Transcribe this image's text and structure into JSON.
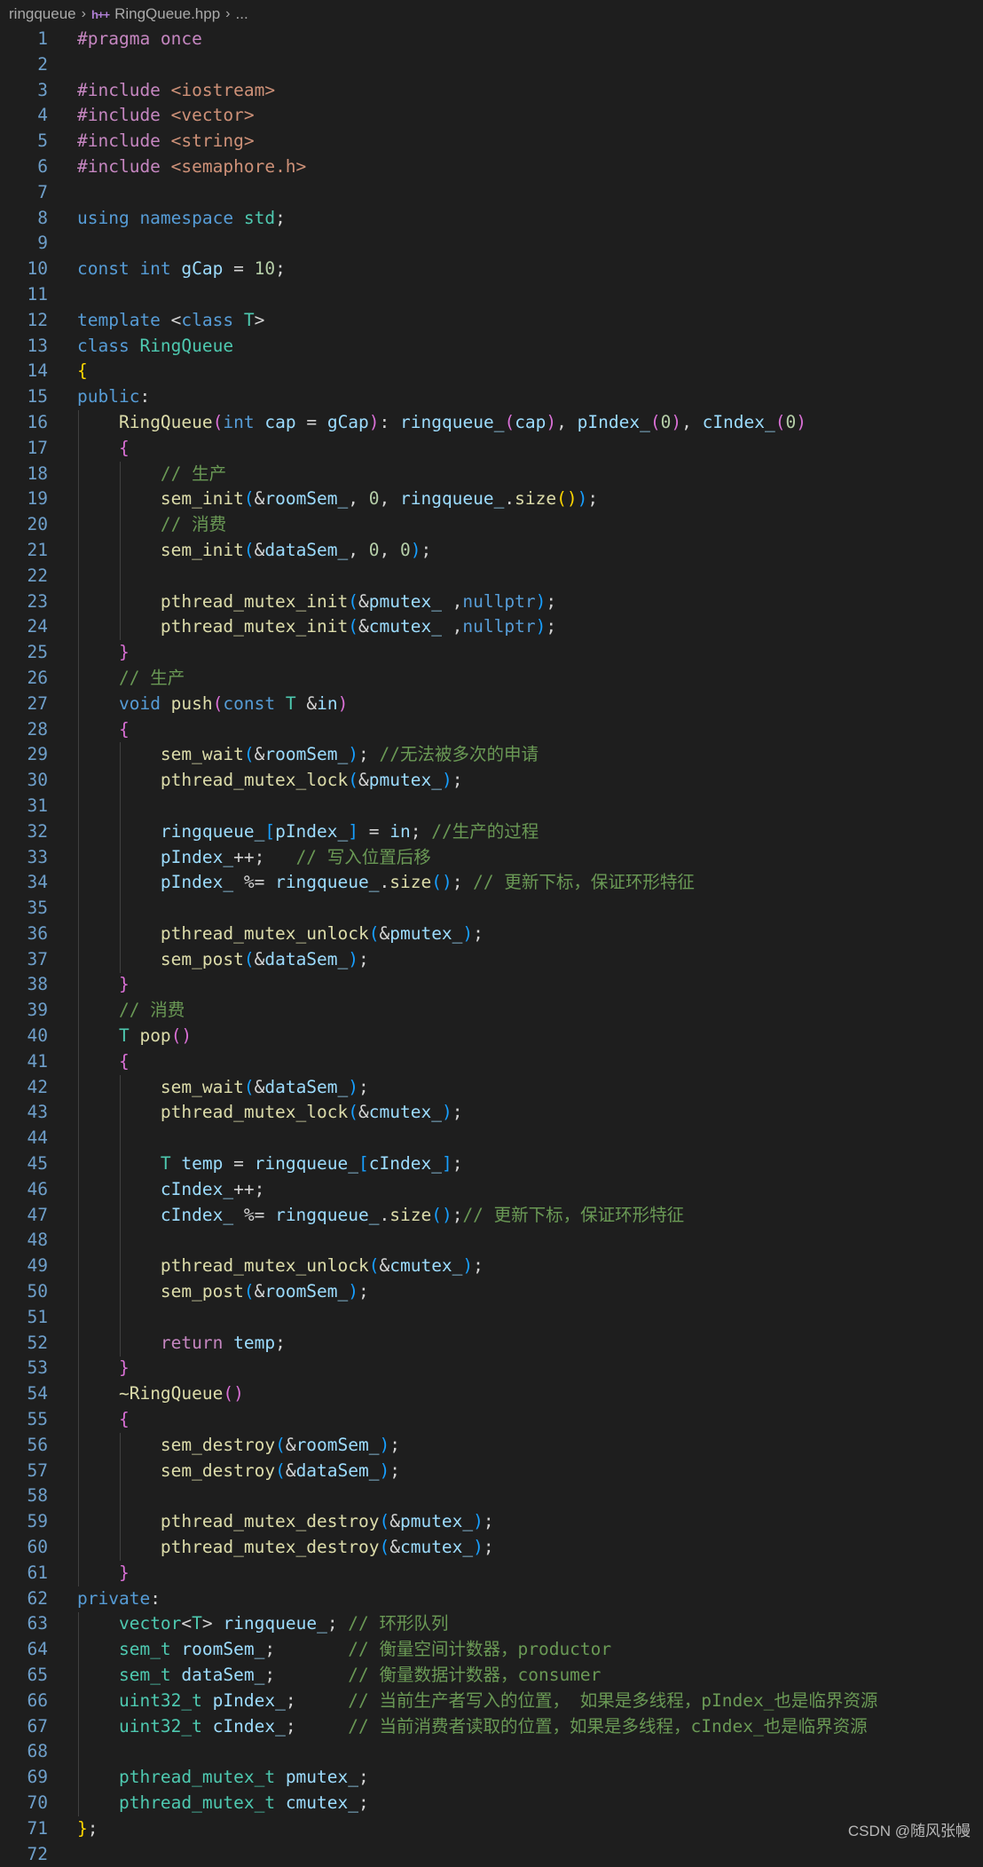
{
  "breadcrumb": {
    "folder": "ringqueue",
    "file_icon": "h++",
    "file": "RingQueue.hpp",
    "more": "..."
  },
  "watermark": "CSDN @随风张幔",
  "colors": {
    "background": "#1e1e1e",
    "line_number": "#6e9fca",
    "keyword": "#569cd6",
    "control": "#c586c0",
    "type": "#4ec9b0",
    "function": "#dcdcaa",
    "variable": "#9cdcfe",
    "string": "#ce9178",
    "number": "#b5cea8",
    "comment": "#6a9955",
    "plain": "#d4d4d4",
    "bracket_gold": "#ffd700",
    "bracket_orchid": "#da70d6",
    "bracket_blue": "#179fff"
  },
  "lines": [
    [
      [
        "pp",
        "#pragma once"
      ]
    ],
    [],
    [
      [
        "pp",
        "#include "
      ],
      [
        "s",
        "<iostream>"
      ]
    ],
    [
      [
        "pp",
        "#include "
      ],
      [
        "s",
        "<vector>"
      ]
    ],
    [
      [
        "pp",
        "#include "
      ],
      [
        "s",
        "<string>"
      ]
    ],
    [
      [
        "pp",
        "#include "
      ],
      [
        "s",
        "<semaphore.h>"
      ]
    ],
    [],
    [
      [
        "k",
        "using namespace "
      ],
      [
        "t",
        "std"
      ],
      [
        "p",
        ";"
      ]
    ],
    [],
    [
      [
        "k",
        "const int "
      ],
      [
        "v",
        "gCap"
      ],
      [
        "p",
        " = "
      ],
      [
        "n",
        "10"
      ],
      [
        "p",
        ";"
      ]
    ],
    [],
    [
      [
        "k",
        "template "
      ],
      [
        "p",
        "<"
      ],
      [
        "k",
        "class "
      ],
      [
        "t",
        "T"
      ],
      [
        "p",
        ">"
      ]
    ],
    [
      [
        "k",
        "class "
      ],
      [
        "t",
        "RingQueue"
      ]
    ],
    [
      [
        "b1",
        "{"
      ]
    ],
    [
      [
        "k",
        "public"
      ],
      [
        "p",
        ":"
      ]
    ],
    [
      [
        "p",
        "    "
      ],
      [
        "f",
        "RingQueue"
      ],
      [
        "b2",
        "("
      ],
      [
        "k",
        "int "
      ],
      [
        "v",
        "cap"
      ],
      [
        "p",
        " = "
      ],
      [
        "v",
        "gCap"
      ],
      [
        "b2",
        ")"
      ],
      [
        "p",
        ": "
      ],
      [
        "v",
        "ringqueue_"
      ],
      [
        "b2",
        "("
      ],
      [
        "v",
        "cap"
      ],
      [
        "b2",
        ")"
      ],
      [
        "p",
        ", "
      ],
      [
        "v",
        "pIndex_"
      ],
      [
        "b2",
        "("
      ],
      [
        "n",
        "0"
      ],
      [
        "b2",
        ")"
      ],
      [
        "p",
        ", "
      ],
      [
        "v",
        "cIndex_"
      ],
      [
        "b2",
        "("
      ],
      [
        "n",
        "0"
      ],
      [
        "b2",
        ")"
      ]
    ],
    [
      [
        "p",
        "    "
      ],
      [
        "b2",
        "{"
      ]
    ],
    [
      [
        "p",
        "        "
      ],
      [
        "cm",
        "// 生产"
      ]
    ],
    [
      [
        "p",
        "        "
      ],
      [
        "f",
        "sem_init"
      ],
      [
        "b3",
        "("
      ],
      [
        "p",
        "&"
      ],
      [
        "v",
        "roomSem_"
      ],
      [
        "p",
        ", "
      ],
      [
        "n",
        "0"
      ],
      [
        "p",
        ", "
      ],
      [
        "v",
        "ringqueue_"
      ],
      [
        "p",
        "."
      ],
      [
        "f",
        "size"
      ],
      [
        "b1",
        "()"
      ],
      [
        "b3",
        ")"
      ],
      [
        "p",
        ";"
      ]
    ],
    [
      [
        "p",
        "        "
      ],
      [
        "cm",
        "// 消费"
      ]
    ],
    [
      [
        "p",
        "        "
      ],
      [
        "f",
        "sem_init"
      ],
      [
        "b3",
        "("
      ],
      [
        "p",
        "&"
      ],
      [
        "v",
        "dataSem_"
      ],
      [
        "p",
        ", "
      ],
      [
        "n",
        "0"
      ],
      [
        "p",
        ", "
      ],
      [
        "n",
        "0"
      ],
      [
        "b3",
        ")"
      ],
      [
        "p",
        ";"
      ]
    ],
    [],
    [
      [
        "p",
        "        "
      ],
      [
        "f",
        "pthread_mutex_init"
      ],
      [
        "b3",
        "("
      ],
      [
        "p",
        "&"
      ],
      [
        "v",
        "pmutex_"
      ],
      [
        "p",
        " ,"
      ],
      [
        "k",
        "nullptr"
      ],
      [
        "b3",
        ")"
      ],
      [
        "p",
        ";"
      ]
    ],
    [
      [
        "p",
        "        "
      ],
      [
        "f",
        "pthread_mutex_init"
      ],
      [
        "b3",
        "("
      ],
      [
        "p",
        "&"
      ],
      [
        "v",
        "cmutex_"
      ],
      [
        "p",
        " ,"
      ],
      [
        "k",
        "nullptr"
      ],
      [
        "b3",
        ")"
      ],
      [
        "p",
        ";"
      ]
    ],
    [
      [
        "p",
        "    "
      ],
      [
        "b2",
        "}"
      ]
    ],
    [
      [
        "p",
        "    "
      ],
      [
        "cm",
        "// 生产"
      ]
    ],
    [
      [
        "p",
        "    "
      ],
      [
        "k",
        "void "
      ],
      [
        "f",
        "push"
      ],
      [
        "b2",
        "("
      ],
      [
        "k",
        "const "
      ],
      [
        "t",
        "T"
      ],
      [
        "p",
        " &"
      ],
      [
        "v",
        "in"
      ],
      [
        "b2",
        ")"
      ]
    ],
    [
      [
        "p",
        "    "
      ],
      [
        "b2",
        "{"
      ]
    ],
    [
      [
        "p",
        "        "
      ],
      [
        "f",
        "sem_wait"
      ],
      [
        "b3",
        "("
      ],
      [
        "p",
        "&"
      ],
      [
        "v",
        "roomSem_"
      ],
      [
        "b3",
        ")"
      ],
      [
        "p",
        "; "
      ],
      [
        "cm",
        "//无法被多次的申请"
      ]
    ],
    [
      [
        "p",
        "        "
      ],
      [
        "f",
        "pthread_mutex_lock"
      ],
      [
        "b3",
        "("
      ],
      [
        "p",
        "&"
      ],
      [
        "v",
        "pmutex_"
      ],
      [
        "b3",
        ")"
      ],
      [
        "p",
        ";"
      ]
    ],
    [],
    [
      [
        "p",
        "        "
      ],
      [
        "v",
        "ringqueue_"
      ],
      [
        "b3",
        "["
      ],
      [
        "v",
        "pIndex_"
      ],
      [
        "b3",
        "]"
      ],
      [
        "p",
        " = "
      ],
      [
        "v",
        "in"
      ],
      [
        "p",
        "; "
      ],
      [
        "cm",
        "//生产的过程"
      ]
    ],
    [
      [
        "p",
        "        "
      ],
      [
        "v",
        "pIndex_"
      ],
      [
        "p",
        "++;   "
      ],
      [
        "cm",
        "// 写入位置后移"
      ]
    ],
    [
      [
        "p",
        "        "
      ],
      [
        "v",
        "pIndex_"
      ],
      [
        "p",
        " %= "
      ],
      [
        "v",
        "ringqueue_"
      ],
      [
        "p",
        "."
      ],
      [
        "f",
        "size"
      ],
      [
        "b3",
        "()"
      ],
      [
        "p",
        "; "
      ],
      [
        "cm",
        "// 更新下标，保证环形特征"
      ]
    ],
    [],
    [
      [
        "p",
        "        "
      ],
      [
        "f",
        "pthread_mutex_unlock"
      ],
      [
        "b3",
        "("
      ],
      [
        "p",
        "&"
      ],
      [
        "v",
        "pmutex_"
      ],
      [
        "b3",
        ")"
      ],
      [
        "p",
        ";"
      ]
    ],
    [
      [
        "p",
        "        "
      ],
      [
        "f",
        "sem_post"
      ],
      [
        "b3",
        "("
      ],
      [
        "p",
        "&"
      ],
      [
        "v",
        "dataSem_"
      ],
      [
        "b3",
        ")"
      ],
      [
        "p",
        ";"
      ]
    ],
    [
      [
        "p",
        "    "
      ],
      [
        "b2",
        "}"
      ]
    ],
    [
      [
        "p",
        "    "
      ],
      [
        "cm",
        "// 消费"
      ]
    ],
    [
      [
        "p",
        "    "
      ],
      [
        "t",
        "T "
      ],
      [
        "f",
        "pop"
      ],
      [
        "b2",
        "()"
      ]
    ],
    [
      [
        "p",
        "    "
      ],
      [
        "b2",
        "{"
      ]
    ],
    [
      [
        "p",
        "        "
      ],
      [
        "f",
        "sem_wait"
      ],
      [
        "b3",
        "("
      ],
      [
        "p",
        "&"
      ],
      [
        "v",
        "dataSem_"
      ],
      [
        "b3",
        ")"
      ],
      [
        "p",
        ";"
      ]
    ],
    [
      [
        "p",
        "        "
      ],
      [
        "f",
        "pthread_mutex_lock"
      ],
      [
        "b3",
        "("
      ],
      [
        "p",
        "&"
      ],
      [
        "v",
        "cmutex_"
      ],
      [
        "b3",
        ")"
      ],
      [
        "p",
        ";"
      ]
    ],
    [],
    [
      [
        "p",
        "        "
      ],
      [
        "t",
        "T "
      ],
      [
        "v",
        "temp"
      ],
      [
        "p",
        " = "
      ],
      [
        "v",
        "ringqueue_"
      ],
      [
        "b3",
        "["
      ],
      [
        "v",
        "cIndex_"
      ],
      [
        "b3",
        "]"
      ],
      [
        "p",
        ";"
      ]
    ],
    [
      [
        "p",
        "        "
      ],
      [
        "v",
        "cIndex_"
      ],
      [
        "p",
        "++;"
      ]
    ],
    [
      [
        "p",
        "        "
      ],
      [
        "v",
        "cIndex_"
      ],
      [
        "p",
        " %= "
      ],
      [
        "v",
        "ringqueue_"
      ],
      [
        "p",
        "."
      ],
      [
        "f",
        "size"
      ],
      [
        "b3",
        "()"
      ],
      [
        "p",
        ";"
      ],
      [
        "cm",
        "// 更新下标，保证环形特征"
      ]
    ],
    [],
    [
      [
        "p",
        "        "
      ],
      [
        "f",
        "pthread_mutex_unlock"
      ],
      [
        "b3",
        "("
      ],
      [
        "p",
        "&"
      ],
      [
        "v",
        "cmutex_"
      ],
      [
        "b3",
        ")"
      ],
      [
        "p",
        ";"
      ]
    ],
    [
      [
        "p",
        "        "
      ],
      [
        "f",
        "sem_post"
      ],
      [
        "b3",
        "("
      ],
      [
        "p",
        "&"
      ],
      [
        "v",
        "roomSem_"
      ],
      [
        "b3",
        ")"
      ],
      [
        "p",
        ";"
      ]
    ],
    [],
    [
      [
        "p",
        "        "
      ],
      [
        "c",
        "return "
      ],
      [
        "v",
        "temp"
      ],
      [
        "p",
        ";"
      ]
    ],
    [
      [
        "p",
        "    "
      ],
      [
        "b2",
        "}"
      ]
    ],
    [
      [
        "p",
        "    "
      ],
      [
        "f",
        "~RingQueue"
      ],
      [
        "b2",
        "()"
      ]
    ],
    [
      [
        "p",
        "    "
      ],
      [
        "b2",
        "{"
      ]
    ],
    [
      [
        "p",
        "        "
      ],
      [
        "f",
        "sem_destroy"
      ],
      [
        "b3",
        "("
      ],
      [
        "p",
        "&"
      ],
      [
        "v",
        "roomSem_"
      ],
      [
        "b3",
        ")"
      ],
      [
        "p",
        ";"
      ]
    ],
    [
      [
        "p",
        "        "
      ],
      [
        "f",
        "sem_destroy"
      ],
      [
        "b3",
        "("
      ],
      [
        "p",
        "&"
      ],
      [
        "v",
        "dataSem_"
      ],
      [
        "b3",
        ")"
      ],
      [
        "p",
        ";"
      ]
    ],
    [],
    [
      [
        "p",
        "        "
      ],
      [
        "f",
        "pthread_mutex_destroy"
      ],
      [
        "b3",
        "("
      ],
      [
        "p",
        "&"
      ],
      [
        "v",
        "pmutex_"
      ],
      [
        "b3",
        ")"
      ],
      [
        "p",
        ";"
      ]
    ],
    [
      [
        "p",
        "        "
      ],
      [
        "f",
        "pthread_mutex_destroy"
      ],
      [
        "b3",
        "("
      ],
      [
        "p",
        "&"
      ],
      [
        "v",
        "cmutex_"
      ],
      [
        "b3",
        ")"
      ],
      [
        "p",
        ";"
      ]
    ],
    [
      [
        "p",
        "    "
      ],
      [
        "b2",
        "}"
      ]
    ],
    [
      [
        "k",
        "private"
      ],
      [
        "p",
        ":"
      ]
    ],
    [
      [
        "p",
        "    "
      ],
      [
        "t",
        "vector"
      ],
      [
        "p",
        "<"
      ],
      [
        "t",
        "T"
      ],
      [
        "p",
        "> "
      ],
      [
        "v",
        "ringqueue_"
      ],
      [
        "p",
        "; "
      ],
      [
        "cm",
        "// 环形队列"
      ]
    ],
    [
      [
        "p",
        "    "
      ],
      [
        "t",
        "sem_t "
      ],
      [
        "v",
        "roomSem_"
      ],
      [
        "p",
        ";       "
      ],
      [
        "cm",
        "// 衡量空间计数器，productor"
      ]
    ],
    [
      [
        "p",
        "    "
      ],
      [
        "t",
        "sem_t "
      ],
      [
        "v",
        "dataSem_"
      ],
      [
        "p",
        ";       "
      ],
      [
        "cm",
        "// 衡量数据计数器，consumer"
      ]
    ],
    [
      [
        "p",
        "    "
      ],
      [
        "t",
        "uint32_t "
      ],
      [
        "v",
        "pIndex_"
      ],
      [
        "p",
        ";     "
      ],
      [
        "cm",
        "// 当前生产者写入的位置， 如果是多线程，pIndex_也是临界资源"
      ]
    ],
    [
      [
        "p",
        "    "
      ],
      [
        "t",
        "uint32_t "
      ],
      [
        "v",
        "cIndex_"
      ],
      [
        "p",
        ";     "
      ],
      [
        "cm",
        "// 当前消费者读取的位置，如果是多线程，cIndex_也是临界资源"
      ]
    ],
    [],
    [
      [
        "p",
        "    "
      ],
      [
        "t",
        "pthread_mutex_t "
      ],
      [
        "v",
        "pmutex_"
      ],
      [
        "p",
        ";"
      ]
    ],
    [
      [
        "p",
        "    "
      ],
      [
        "t",
        "pthread_mutex_t "
      ],
      [
        "v",
        "cmutex_"
      ],
      [
        "p",
        ";"
      ]
    ],
    [
      [
        "b1",
        "}"
      ],
      [
        "p",
        ";"
      ]
    ],
    []
  ]
}
